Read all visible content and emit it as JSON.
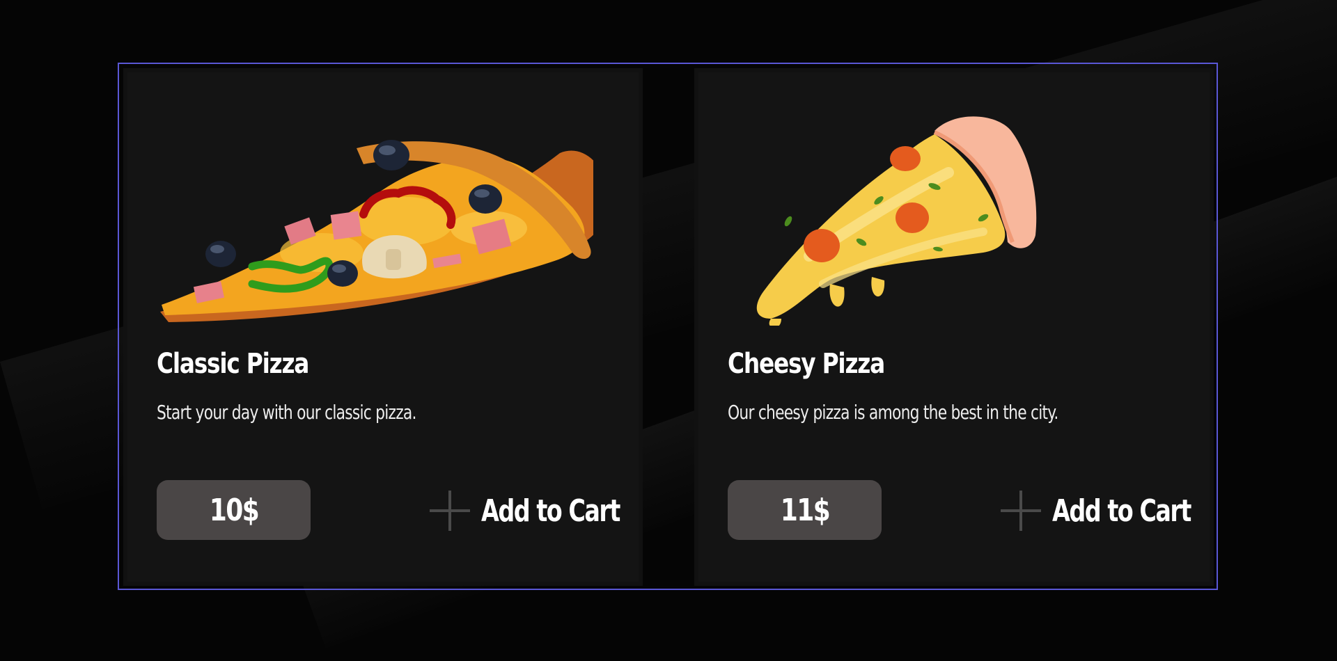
{
  "products": [
    {
      "title": "Classic Pizza",
      "description": "Start your day with our classic pizza.",
      "price": "10$",
      "cart_label": "Add to Cart",
      "image": "classic-pizza-slice"
    },
    {
      "title": "Cheesy Pizza",
      "description": "Our cheesy pizza is among the best in the city.",
      "price": "11$",
      "cart_label": "Add to Cart",
      "image": "cheesy-pizza-slice"
    }
  ],
  "colors": {
    "background": "#050505",
    "card": "#141414",
    "frame_border": "#5a57d6",
    "price_badge": "#4a4646",
    "plus_icon": "#4a4a4a",
    "text": "#ffffff"
  }
}
